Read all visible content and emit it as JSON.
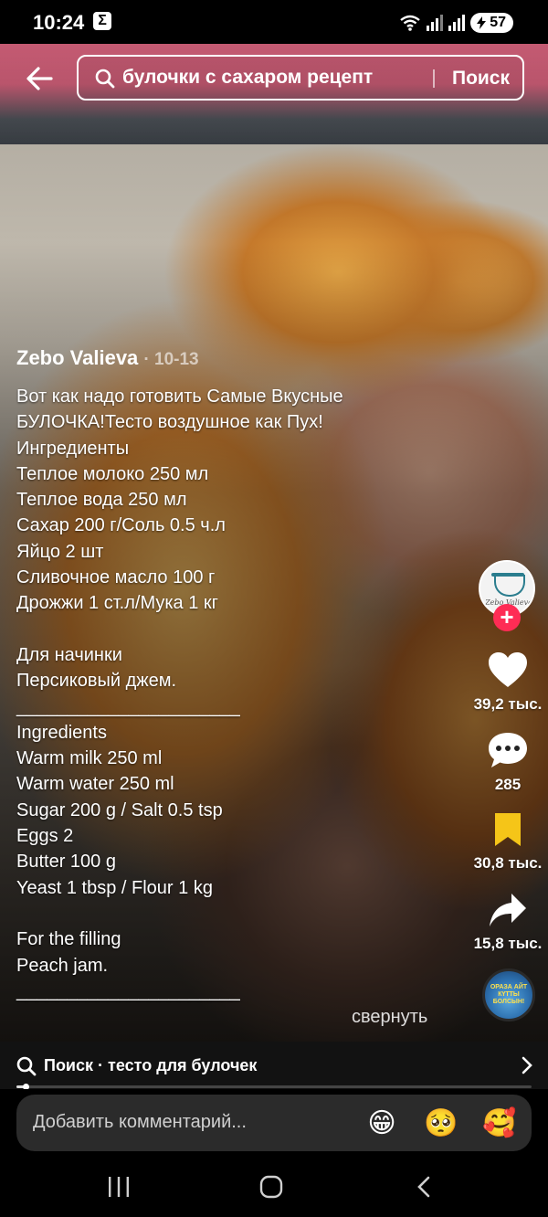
{
  "status_bar": {
    "time": "10:24",
    "notification": "Σ",
    "battery": "57"
  },
  "header": {
    "search_query": "булочки с сахаром рецепт",
    "search_button": "Поиск"
  },
  "post": {
    "author": "Zebo Valieva",
    "date": "· 10-13",
    "caption_lines": [
      "Вот как надо готовить Самые Вкусные",
      "БУЛОЧКА!Тесто воздушное как Пух!",
      "Ингредиенты",
      "Теплое молоко 250 мл",
      "Теплое вода 250 мл",
      "Сахар 200 г/Соль 0.5 ч.л",
      "Яйцо 2 шт",
      "Сливочное масло 100 г",
      "Дрожжи 1 ст.л/Мука 1 кг",
      "",
      "Для начинки",
      "Персиковый джем.",
      "______________________",
      "Ingredients",
      "Warm milk 250 ml",
      "Warm water 250 ml",
      "Sugar 200 g / Salt 0.5 tsp",
      "Eggs 2",
      "Butter 100 g",
      "Yeast 1 tbsp / Flour 1 kg",
      "",
      "For the filling",
      "Peach jam.",
      "______________________"
    ],
    "collapse_label": "свернуть"
  },
  "actions": {
    "avatar_text": "Zebo Valieva",
    "likes": "39,2 тыс.",
    "comments": "285",
    "saves": "30,8 тыс.",
    "shares": "15,8 тыс.",
    "music_text": "ОРАЗА АЙТ КҮТТЫ БОЛСЫН!"
  },
  "related_search": {
    "label": "Поиск · тесто для булочек"
  },
  "progress": {
    "fraction": 0.02
  },
  "comment": {
    "placeholder": "Добавить комментарий...",
    "emojis": [
      "😁",
      "🥺",
      "🥰"
    ]
  },
  "colors": {
    "accent": "#fe2c55",
    "save": "#f5c518"
  }
}
